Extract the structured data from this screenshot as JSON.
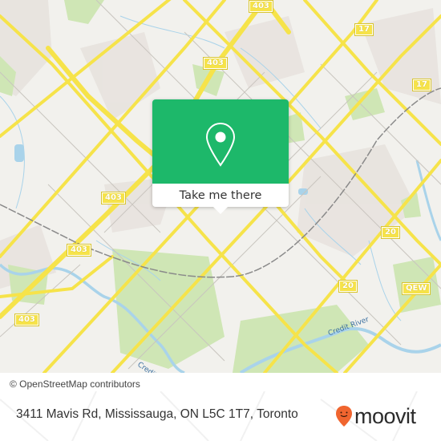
{
  "map": {
    "background_color": "#f2f1ed",
    "road_color": "#f6e34a",
    "water_color": "#a9d3ea",
    "park_color": "#cfe6b5",
    "railway_color": "#8a8a8a",
    "shields": [
      {
        "label": "403"
      },
      {
        "label": "17"
      },
      {
        "label": "403"
      },
      {
        "label": "17"
      },
      {
        "label": "403"
      },
      {
        "label": "403"
      },
      {
        "label": "403"
      },
      {
        "label": "20"
      },
      {
        "label": "20"
      },
      {
        "label": "QEW"
      }
    ],
    "water_labels": [
      {
        "label": "Credit R."
      },
      {
        "label": "Credit River"
      }
    ],
    "attribution": "© OpenStreetMap contributors"
  },
  "popup": {
    "icon": "map-pin-icon",
    "button_label": "Take me there",
    "accent_color": "#1db86a"
  },
  "footer": {
    "address": "3411 Mavis Rd, Mississauga, ON L5C 1T7, Toronto",
    "logo_icon": "moovit-pin-icon",
    "logo_text": "moovit",
    "logo_color": "#f0652f"
  }
}
